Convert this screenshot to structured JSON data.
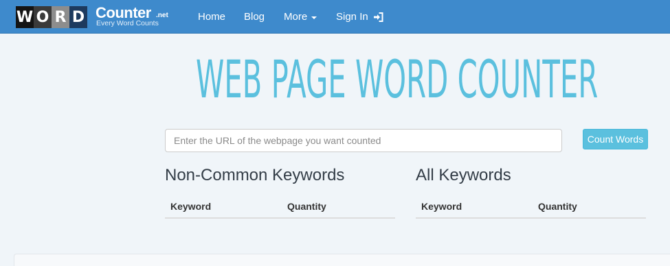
{
  "brand": {
    "tiles": [
      "W",
      "O",
      "R",
      "D"
    ],
    "name": "Counter",
    "tld": ".net",
    "tagline": "Every Word Counts"
  },
  "nav": {
    "home": "Home",
    "blog": "Blog",
    "more": "More",
    "signin": "Sign In"
  },
  "icons": {
    "more_caret": "caret-down-icon",
    "signin": "sign-in-icon"
  },
  "title": "WEB PAGE WORD COUNTER",
  "form": {
    "url_placeholder": "Enter the URL of the webpage you want counted",
    "url_value": "",
    "submit_label": "Count Words"
  },
  "panels": {
    "non_common": {
      "heading": "Non-Common Keywords",
      "columns": [
        "Keyword",
        "Quantity"
      ],
      "rows": []
    },
    "all": {
      "heading": "All Keywords",
      "columns": [
        "Keyword",
        "Quantity"
      ],
      "rows": []
    }
  },
  "colors": {
    "navbar": "#3e8acc",
    "accent": "#5bc0de",
    "background": "#f0f5f9"
  }
}
